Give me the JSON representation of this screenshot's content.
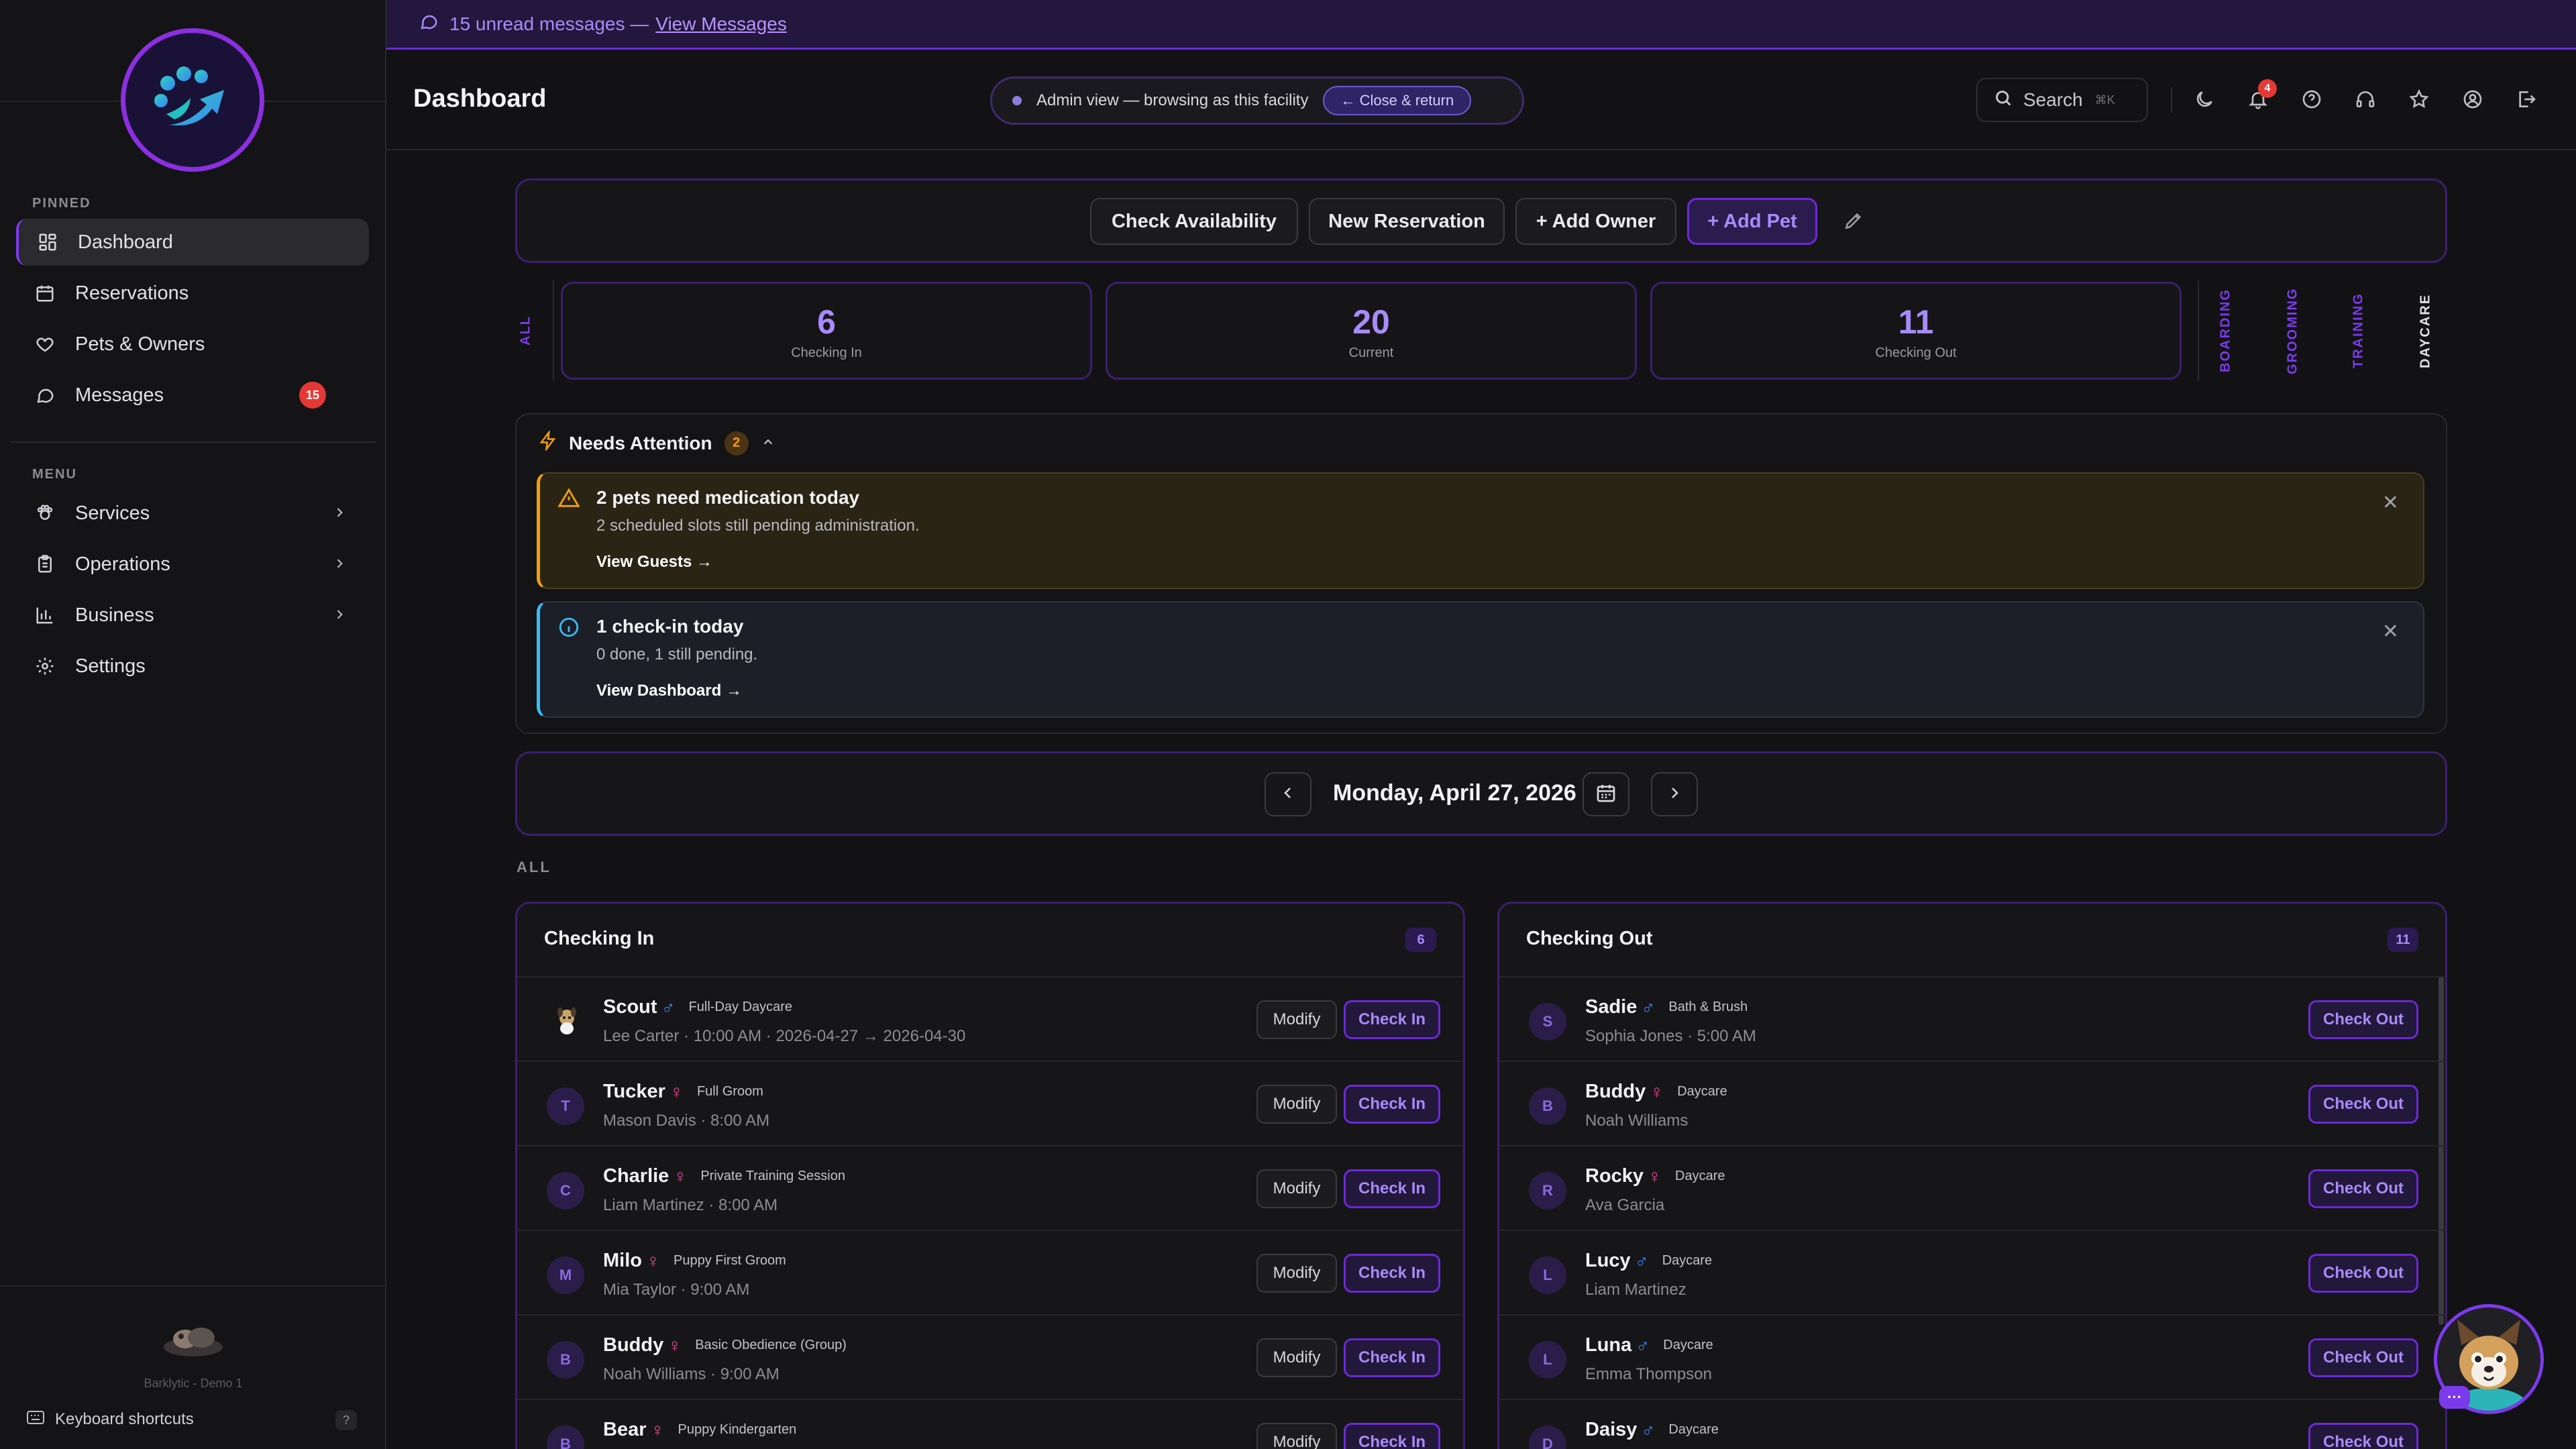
{
  "banner": {
    "text": "15 unread messages —",
    "link": "View Messages"
  },
  "header": {
    "title": "Dashboard",
    "admin_text": "Admin view — browsing as this facility",
    "close_label": "← Close & return",
    "search_label": "Search",
    "search_shortcut": "⌘K",
    "notification_count": "4"
  },
  "sidebar": {
    "pinned_label": "PINNED",
    "menu_label": "MENU",
    "pinned": [
      {
        "label": "Dashboard",
        "icon": "grid-icon"
      },
      {
        "label": "Reservations",
        "icon": "calendar-icon"
      },
      {
        "label": "Pets & Owners",
        "icon": "heart-icon"
      },
      {
        "label": "Messages",
        "icon": "message-icon",
        "badge": "15"
      }
    ],
    "menu": [
      {
        "label": "Services",
        "icon": "paw-icon"
      },
      {
        "label": "Operations",
        "icon": "clipboard-icon"
      },
      {
        "label": "Business",
        "icon": "bar-chart-icon"
      },
      {
        "label": "Settings",
        "icon": "gear-icon"
      }
    ],
    "footer_caption": "Barklytic - Demo 1",
    "keyboard_label": "Keyboard shortcuts",
    "keyboard_hint": "?"
  },
  "actions": {
    "check_availability": "Check Availability",
    "new_reservation": "New Reservation",
    "add_owner": "+ Add Owner",
    "add_pet": "+ Add Pet"
  },
  "stats": {
    "all_tab": "ALL",
    "checking_in": {
      "value": "6",
      "label": "Checking In"
    },
    "current": {
      "value": "20",
      "label": "Current"
    },
    "checking_out": {
      "value": "11",
      "label": "Checking Out"
    },
    "tabs": [
      "BOARDING",
      "GROOMING",
      "TRAINING",
      "DAYCARE"
    ]
  },
  "attention": {
    "title": "Needs Attention",
    "count": "2",
    "alerts": [
      {
        "title": "2 pets need medication today",
        "subtitle": "2 scheduled slots still pending administration.",
        "link": "View Guests →"
      },
      {
        "title": "1 check-in today",
        "subtitle": "0 done, 1 still pending.",
        "link": "View Dashboard →"
      }
    ]
  },
  "date_nav": {
    "date": "Monday, April 27, 2026"
  },
  "section_label": "ALL",
  "checking_in": {
    "title": "Checking In",
    "count": "6",
    "modify_label": "Modify",
    "action_label": "Check In",
    "rows": [
      {
        "initial": "",
        "name": "Scout",
        "gender": "♂",
        "service": "Full-Day Daycare",
        "owner": "Lee Carter",
        "time": "10:00 AM",
        "dates": "2026-04-27 → 2026-04-30"
      },
      {
        "initial": "T",
        "name": "Tucker",
        "gender": "♀",
        "service": "Full Groom",
        "owner": "Mason Davis",
        "time": "8:00 AM"
      },
      {
        "initial": "C",
        "name": "Charlie",
        "gender": "♀",
        "service": "Private Training Session",
        "owner": "Liam Martinez",
        "time": "8:00 AM"
      },
      {
        "initial": "M",
        "name": "Milo",
        "gender": "♀",
        "service": "Puppy First Groom",
        "owner": "Mia Taylor",
        "time": "9:00 AM"
      },
      {
        "initial": "B",
        "name": "Buddy",
        "gender": "♀",
        "service": "Basic Obedience (Group)",
        "owner": "Noah Williams",
        "time": "9:00 AM"
      },
      {
        "initial": "B",
        "name": "Bear",
        "gender": "♀",
        "service": "Puppy Kindergarten",
        "owner": "",
        "time": ""
      }
    ]
  },
  "checking_out": {
    "title": "Checking Out",
    "count": "11",
    "action_label": "Check Out",
    "rows": [
      {
        "initial": "S",
        "name": "Sadie",
        "gender": "♂",
        "service": "Bath & Brush",
        "owner": "Sophia Jones",
        "time": "5:00 AM"
      },
      {
        "initial": "B",
        "name": "Buddy",
        "gender": "♀",
        "service": "Daycare",
        "owner": "Noah Williams",
        "time": ""
      },
      {
        "initial": "R",
        "name": "Rocky",
        "gender": "♀",
        "service": "Daycare",
        "owner": "Ava Garcia",
        "time": ""
      },
      {
        "initial": "L",
        "name": "Lucy",
        "gender": "♂",
        "service": "Daycare",
        "owner": "Liam Martinez",
        "time": ""
      },
      {
        "initial": "L",
        "name": "Luna",
        "gender": "♂",
        "service": "Daycare",
        "owner": "Emma Thompson",
        "time": ""
      },
      {
        "initial": "D",
        "name": "Daisy",
        "gender": "♂",
        "service": "Daycare",
        "owner": "",
        "time": ""
      }
    ]
  },
  "colors": {
    "accent": "#7c3aed",
    "accent_text": "#a78bfa",
    "warning": "#f59e0b",
    "info": "#38bdf8",
    "badge_red": "#e53935"
  }
}
